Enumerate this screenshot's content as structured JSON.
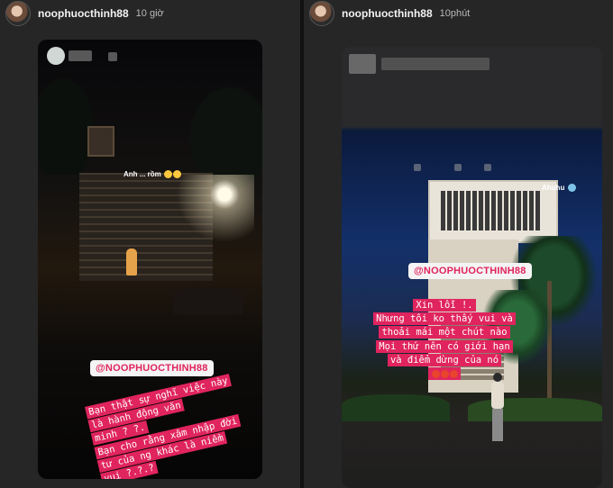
{
  "left_post": {
    "username": "noophuocthinh88",
    "time": "10 giờ",
    "small_caption": "Anh ... rồm",
    "mention_tag": "@NOOPHUOCTHINH88",
    "caption_lines": [
      "Bạn thật sự nghĩ việc này",
      "là hành động văn",
      "minh ? ?.",
      "Bạn cho rằng xâm nhập đời",
      "tư của ng khác là niềm",
      "vui ?.?.?"
    ]
  },
  "right_post": {
    "username": "noophuocthinh88",
    "time": "10phút",
    "small_caption": "Ahuhu",
    "mention_tag": "@NOOPHUOCTHINH88",
    "caption_lines": [
      "Xin lỗi !.",
      "Nhưng tôi ko thấy vui và",
      "thoải mái một chút nào",
      "Mọi thứ nên có giới hạn",
      "và điểm dừng của nó"
    ]
  },
  "colors": {
    "accent": "#e0245e",
    "panel": "#262626"
  }
}
